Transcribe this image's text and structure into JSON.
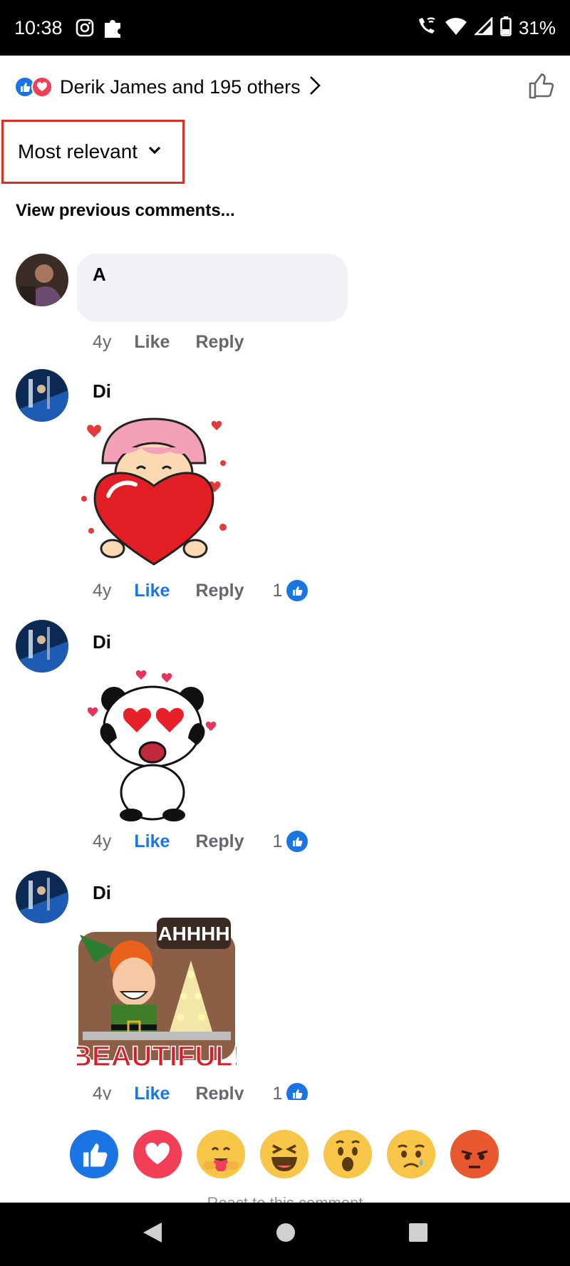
{
  "status_bar": {
    "time": "10:38",
    "battery": "31%",
    "icons": [
      "instagram-icon",
      "puzzle-icon",
      "wifi-call-icon",
      "wifi-icon",
      "signal-icon",
      "battery-icon"
    ]
  },
  "reactions_header": {
    "text": "Derik James and 195 others",
    "reaction_types": [
      "like",
      "love"
    ]
  },
  "sort": {
    "label": "Most relevant"
  },
  "view_previous": "View previous comments...",
  "comments": [
    {
      "author": "A",
      "time": "4y",
      "like_label": "Like",
      "reply_label": "Reply",
      "liked": false
    },
    {
      "author": "Di",
      "time": "4y",
      "like_label": "Like",
      "reply_label": "Reply",
      "liked": true,
      "reaction_count": "1",
      "sticker": "girl-heart-sticker"
    },
    {
      "author": "Di",
      "time": "4y",
      "like_label": "Like",
      "reply_label": "Reply",
      "liked": true,
      "reaction_count": "1",
      "sticker": "panda-love-sticker"
    },
    {
      "author": "Di",
      "time": "4y",
      "like_label": "Like",
      "reply_label": "Reply",
      "liked": true,
      "reaction_count": "1",
      "sticker": "beautiful-elf-sticker",
      "sticker_text": {
        "top": "AHHHH",
        "bottom": "BEAUTIFUL!"
      }
    }
  ],
  "reaction_picker": [
    "like",
    "love",
    "care",
    "haha",
    "wow",
    "sad",
    "angry"
  ],
  "react_hint": "React to this comment",
  "colors": {
    "accent": "#1b74e4",
    "love": "#f33e58",
    "highlight_border": "#d93025",
    "muted_text": "#65676b",
    "bubble": "#f0f2f5"
  }
}
